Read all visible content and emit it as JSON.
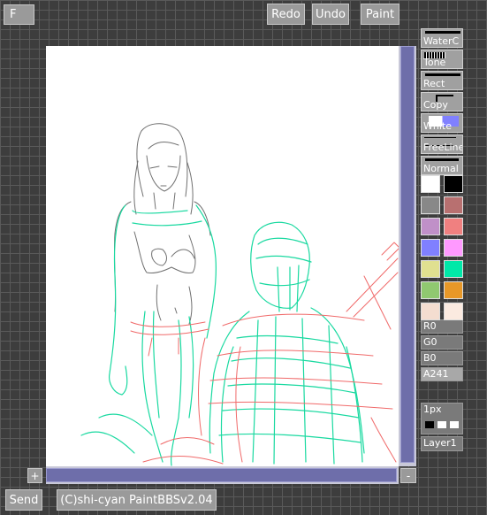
{
  "toolbar": {
    "f_label": "F",
    "redo_label": "Redo",
    "undo_label": "Undo",
    "paint_label": "Paint"
  },
  "tools": {
    "brush_label": "WaterC",
    "tone_label": "Tone",
    "shape_label": "Rect",
    "edit_label": "Copy",
    "color_mode_label": "White",
    "line_label": "FreeLine",
    "mode_label": "Normal"
  },
  "palette": {
    "colors": [
      "#ffffff",
      "#000000",
      "#888888",
      "#b87070",
      "#c090c8",
      "#f08080",
      "#8080ff",
      "#ff99ff",
      "#e0e090",
      "#00e8a8",
      "#90c870",
      "#e89828",
      "#f4ddd0",
      "#fbeae0"
    ]
  },
  "color_values": {
    "r": "R0",
    "g": "G0",
    "b": "B0",
    "a": "A241"
  },
  "brush_size": "1px",
  "layer": "Layer1",
  "canvas_controls": {
    "zoom_in": "+",
    "zoom_out": "-"
  },
  "footer": {
    "send_label": "Send",
    "credit": "(C)shi-cyan PaintBBSv2.04"
  },
  "sketch_colors": {
    "pencil": "#707070",
    "green": "#19d9a0",
    "red": "#f06a6a"
  }
}
